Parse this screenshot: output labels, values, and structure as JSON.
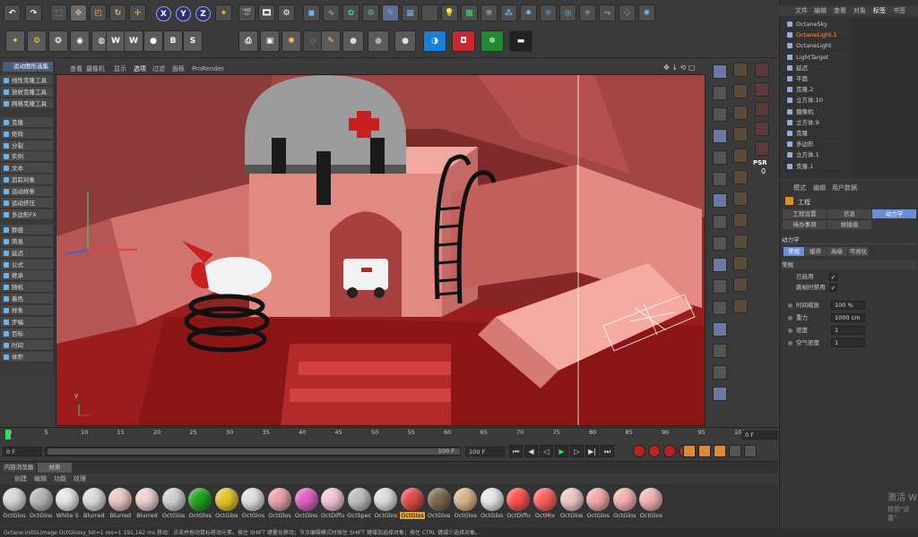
{
  "toolbar": {
    "axis_x": "X",
    "axis_y": "Y",
    "axis_z": "Z"
  },
  "viewport_menu": [
    "查看",
    "摄像机",
    "显示",
    "选项",
    "过滤",
    "面板",
    "ProRender"
  ],
  "left_panel": {
    "title": "运动图形选集",
    "items": [
      "线性克隆工具",
      "放射克隆工具",
      "网格克隆工具",
      "克隆",
      "矩阵",
      "分裂",
      "实例",
      "文本",
      "追踪对象",
      "运动样条",
      "运动挤压",
      "多边形FX",
      "群组",
      "简易",
      "延迟",
      "公式",
      "继承",
      "随机",
      "着色",
      "样条",
      "步幅",
      "目标",
      "时间",
      "体积"
    ]
  },
  "right_tool_labels": {
    "psr": "PSR",
    "psr_value": "0"
  },
  "object_manager": {
    "menu": [
      "文件",
      "编辑",
      "查看",
      "对象",
      "标签",
      "书签"
    ],
    "objects": [
      "OctaneSky",
      "OctaneLight.1",
      "OctaneLight",
      "LightTarget",
      "延迟",
      "平面",
      "克隆.2",
      "立方体.10",
      "摄像机",
      "立方体.9",
      "克隆",
      "多边形",
      "立方体.1",
      "克隆.1"
    ]
  },
  "attribute_manager": {
    "menu": [
      "模式",
      "编辑",
      "用户数据"
    ],
    "title": "工程",
    "tabs_row1": [
      "工程设置",
      "信息",
      "动力学"
    ],
    "tabs_row2": [
      "待办事项",
      "帧插值"
    ],
    "section": "动力学",
    "subtabs": [
      "常规",
      "缓存",
      "高级",
      "可视化"
    ],
    "group": "常规",
    "enabled_label": "已启用",
    "disable_on_jump_label": "跳帧时禁用",
    "params": [
      {
        "label": "时间缩放",
        "value": "100 %"
      },
      {
        "label": "重力",
        "value": "1000 cm"
      },
      {
        "label": "密度",
        "value": "1"
      },
      {
        "label": "空气密度",
        "value": "1"
      }
    ]
  },
  "timeline": {
    "ticks": [
      "0",
      "5",
      "10",
      "15",
      "20",
      "25",
      "30",
      "35",
      "40",
      "45",
      "50",
      "55",
      "60",
      "65",
      "70",
      "75",
      "80",
      "85",
      "90",
      "95",
      "100"
    ],
    "current_frame": "0 F",
    "start_frame": "0 F",
    "end_frame": "100 F",
    "max_frame": "100 F",
    "right_frame": "0 F"
  },
  "material_manager": {
    "tabs": [
      "内容浏览器",
      "材质"
    ],
    "menu": [
      "创建",
      "编辑",
      "功能",
      "纹理"
    ],
    "materials": [
      {
        "name": "OctGlos",
        "color": "#d8d8d8"
      },
      {
        "name": "OctGlos",
        "color": "#b5b5b5"
      },
      {
        "name": "White S",
        "color": "#e8e8e8"
      },
      {
        "name": "Blurred",
        "color": "#dcdcdc"
      },
      {
        "name": "Blurred",
        "color": "#f1c6c6"
      },
      {
        "name": "Blurred",
        "color": "#f0d0d0"
      },
      {
        "name": "OctGlos",
        "color": "#d0d0d0"
      },
      {
        "name": "OctGlos",
        "color": "#1fa31f"
      },
      {
        "name": "OctGlos",
        "color": "#e5c428"
      },
      {
        "name": "OctGlos",
        "color": "#e0e0e0"
      },
      {
        "name": "OctGlos",
        "color": "#e8a0a8"
      },
      {
        "name": "OctGlos",
        "color": "#e060c0"
      },
      {
        "name": "OctDiffu",
        "color": "#f4c6d6"
      },
      {
        "name": "OctSpec",
        "color": "#bdbdbd"
      },
      {
        "name": "OctGlos",
        "color": "#dedede"
      },
      {
        "name": "OctGlos",
        "color": "#e04a4a"
      },
      {
        "name": "OctGlos",
        "color": "#7a6a50"
      },
      {
        "name": "OctGlos",
        "color": "#d9b58a"
      },
      {
        "name": "OctGlos",
        "color": "#e8e8e8"
      },
      {
        "name": "OctDiffu",
        "color": "#ff5050"
      },
      {
        "name": "OctMix",
        "color": "#ff5f5f"
      },
      {
        "name": "OctGlos",
        "color": "#f0c8c8"
      },
      {
        "name": "OctGlos",
        "color": "#f4a8a8"
      },
      {
        "name": "OctGlos",
        "color": "#f6b0b0"
      },
      {
        "name": "OctGlos",
        "color": "#f2b4b4"
      }
    ]
  },
  "status_bar": "Octane:initGLImage OctGlossy_bit=1 res=1 191,162 ms    移动：点击并拖动鼠标移动元素。按住 SHIFT 键量化移动；节点编辑模式时按住 SHIFT 键增加选择对象；按住 CTRL 键减少选择对象。",
  "watermark": {
    "line1": "激活 W",
    "line2": "转到\"设置\""
  },
  "colors": {
    "accent": "#6a8fd6",
    "selected_object": "#ff9a3c",
    "active_material_label": "#e1a33a"
  }
}
